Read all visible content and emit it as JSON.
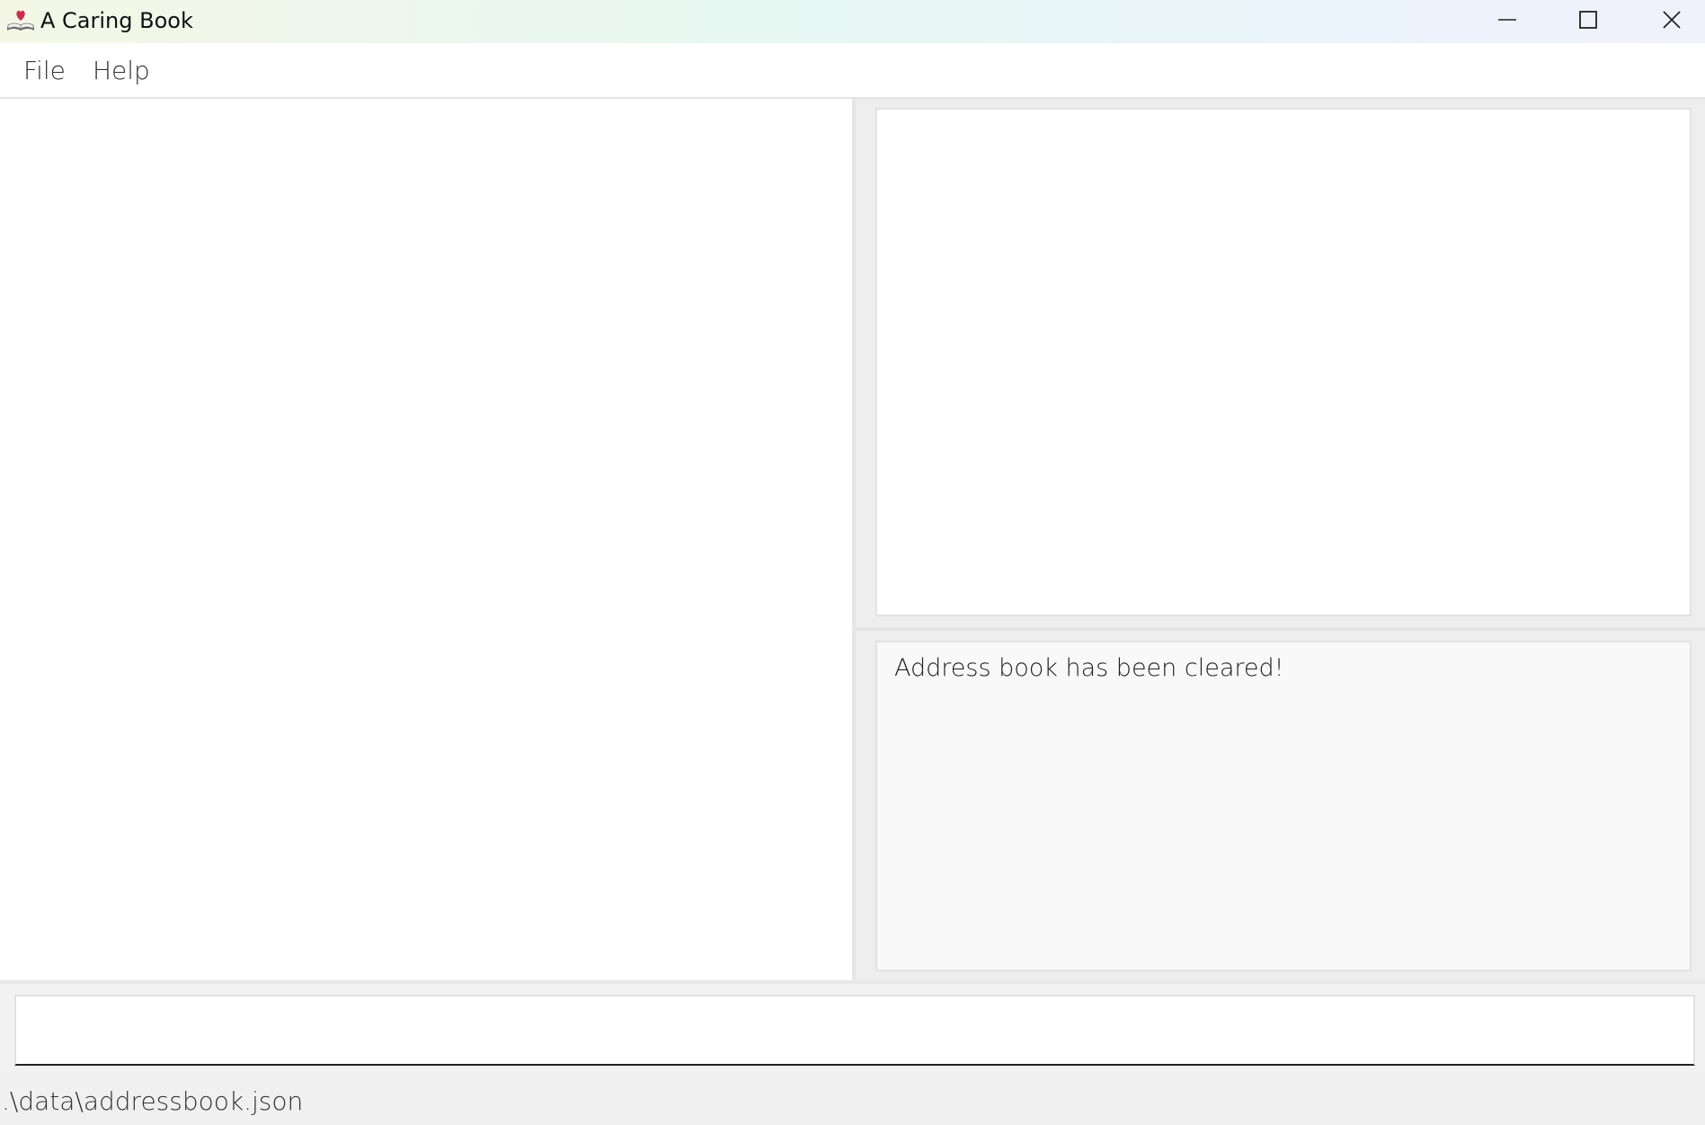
{
  "window": {
    "title": "A Caring Book",
    "icon": "book-heart-icon"
  },
  "menubar": {
    "items": [
      {
        "label": "File"
      },
      {
        "label": "Help"
      }
    ]
  },
  "result_display": {
    "message": "Address book has been cleared!"
  },
  "command_box": {
    "value": "",
    "placeholder": ""
  },
  "statusbar": {
    "file_path": ".\\data\\addressbook.json"
  },
  "colors": {
    "heart": "#d42a4a",
    "panel_background": "#eeeeee",
    "result_background": "#f9f9f9"
  }
}
